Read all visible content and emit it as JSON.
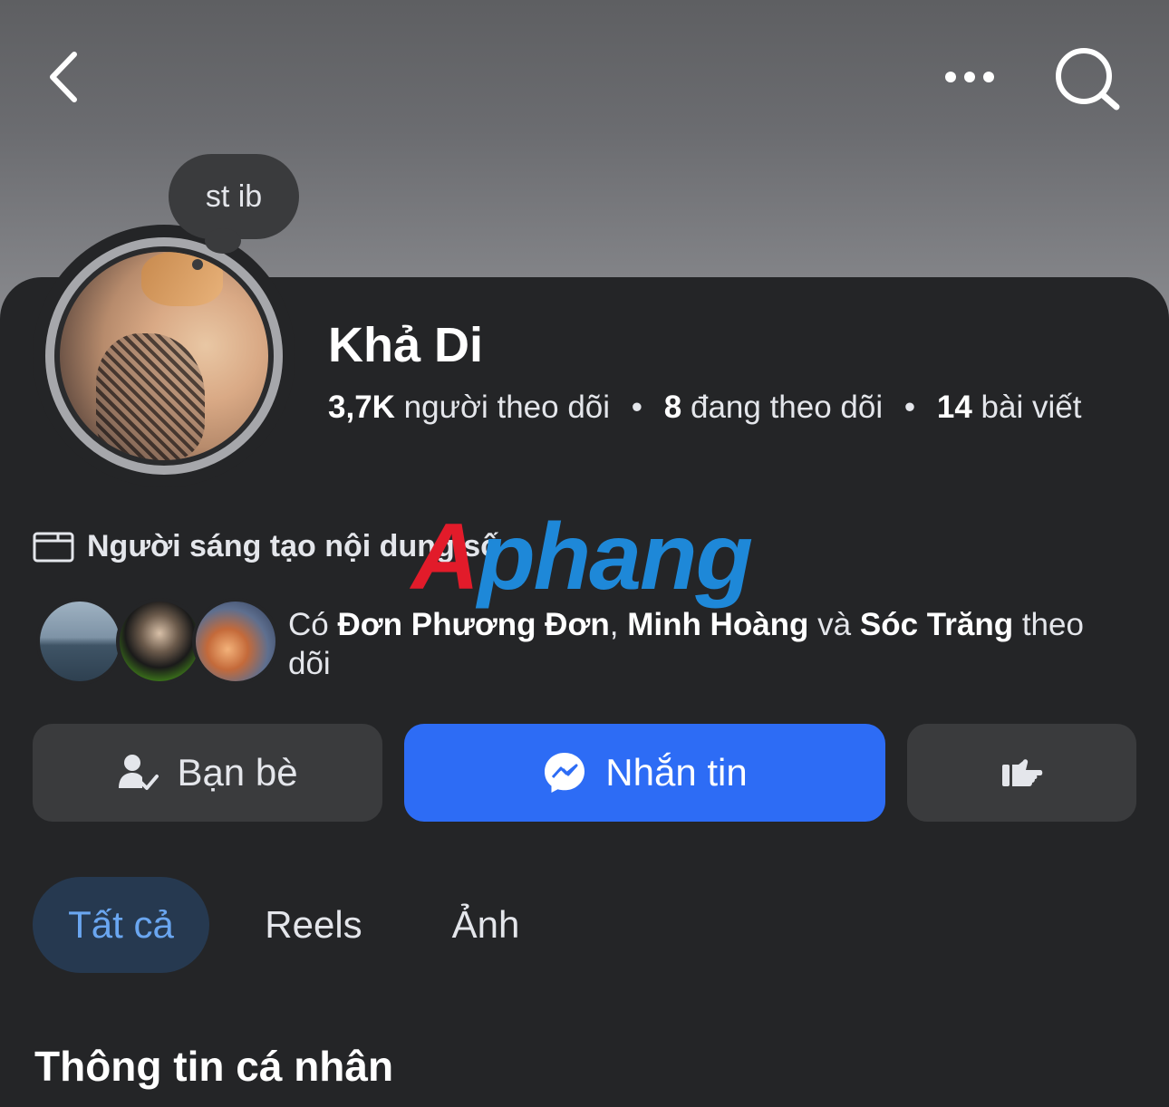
{
  "header": {
    "back_icon": "chevron-left-icon",
    "more_icon": "more-dots-icon",
    "search_icon": "search-icon"
  },
  "note": {
    "text": "st ib"
  },
  "profile": {
    "name": "Khả Di",
    "followers_count": "3,7K",
    "followers_label": "người theo dõi",
    "following_count": "8",
    "following_label": "đang theo dõi",
    "posts_count": "14",
    "posts_label": "bài viết",
    "separator": "•",
    "category": "Người sáng tạo nội dung số",
    "category_icon": "creator-icon"
  },
  "watermark": {
    "part1": "A",
    "part2": "phang"
  },
  "mutuals": {
    "prefix": "Có",
    "name1": "Đơn Phương Đơn",
    "comma": ",",
    "name2": "Minh Hoàng",
    "and": "và",
    "name3": "Sóc Trăng",
    "suffix": "theo dõi"
  },
  "actions": {
    "friends_label": "Bạn bè",
    "friends_icon": "friend-check-icon",
    "message_label": "Nhắn tin",
    "message_icon": "messenger-icon",
    "more_icon": "thumbs-hand-icon",
    "colors": {
      "primary": "#2d6cf5",
      "secondary": "#3a3b3d"
    }
  },
  "tabs": [
    {
      "label": "Tất cả",
      "active": true
    },
    {
      "label": "Reels",
      "active": false
    },
    {
      "label": "Ảnh",
      "active": false
    }
  ],
  "section": {
    "title": "Thông tin cá nhân"
  }
}
